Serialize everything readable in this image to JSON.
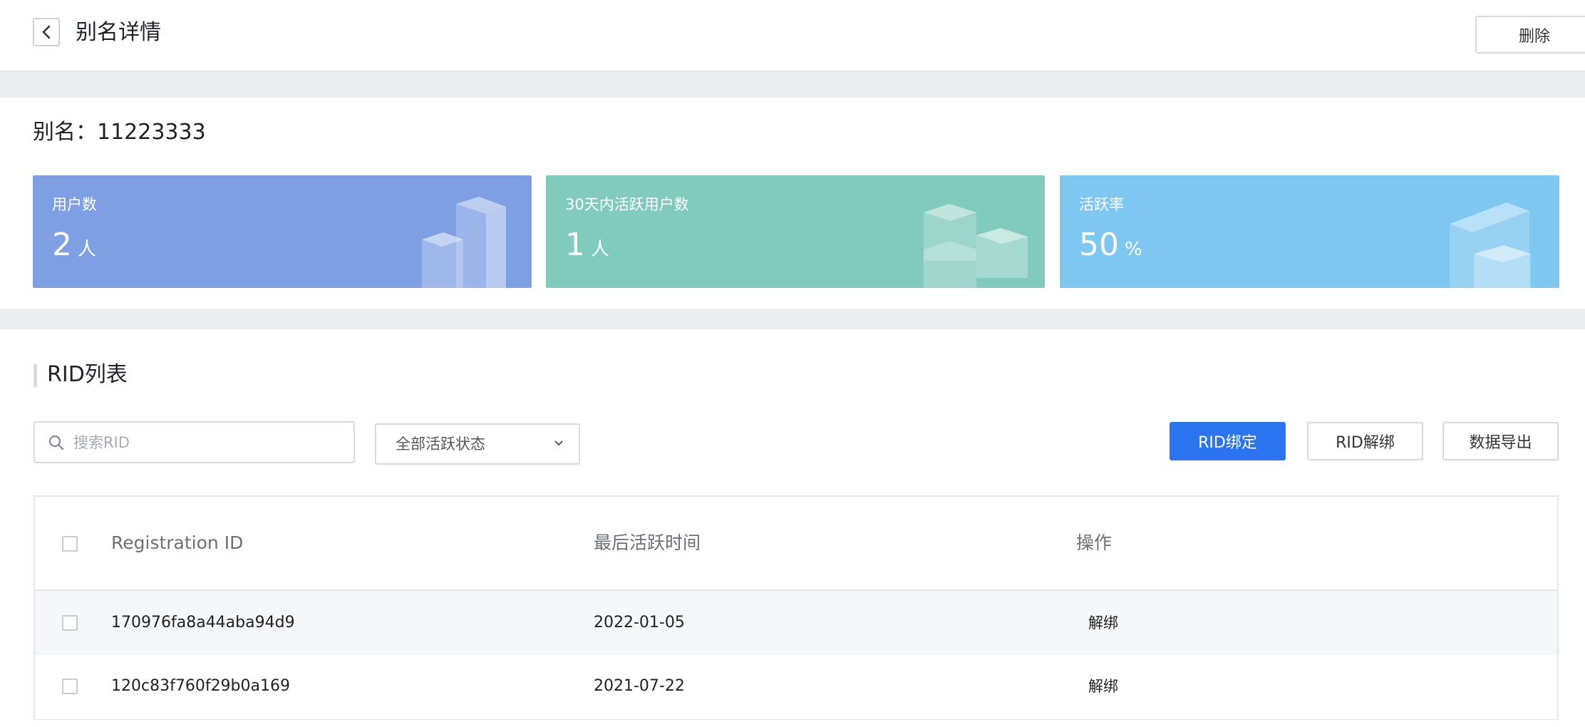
{
  "header": {
    "title": "别名详情",
    "delete_label": "删除"
  },
  "alias": {
    "label": "别名：11223333"
  },
  "stats": [
    {
      "label": "用户数",
      "value": "2",
      "unit": "人",
      "color": "#7f9fe4"
    },
    {
      "label": "30天内活跃用户数",
      "value": "1",
      "unit": "人",
      "color": "#80cbbc"
    },
    {
      "label": "活跃率",
      "value": "50",
      "unit": "%",
      "color": "#7ec7f1"
    }
  ],
  "rid_section": {
    "title": "RID列表",
    "search_placeholder": "搜索RID",
    "status_filter": "全部活跃状态",
    "bind_label": "RID绑定",
    "unbind_label": "RID解绑",
    "export_label": "数据导出"
  },
  "table": {
    "columns": [
      "Registration ID",
      "最后活跃时间",
      "操作"
    ],
    "rows": [
      {
        "rid": "170976fa8a44aba94d9",
        "last_active": "2022-01-05",
        "action": "解绑"
      },
      {
        "rid": "120c83f760f29b0a169",
        "last_active": "2021-07-22",
        "action": "解绑"
      }
    ]
  },
  "colors": {
    "primary": "#2a74f0"
  }
}
